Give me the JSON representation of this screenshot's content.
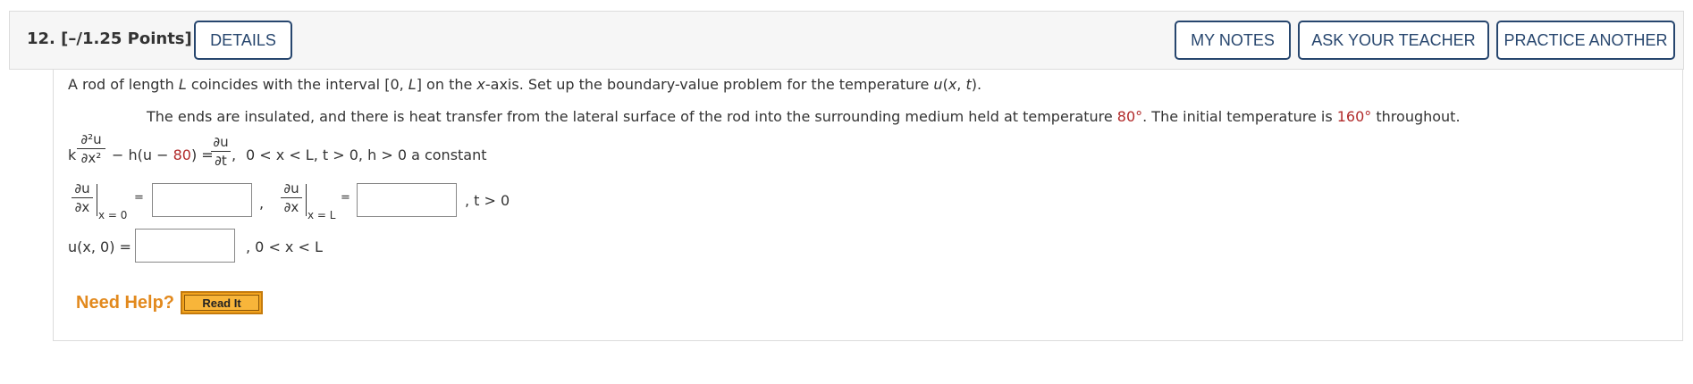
{
  "header": {
    "question_number": "12.",
    "points": "[–/1.25 Points]",
    "details_label": "DETAILS",
    "my_notes_label": "MY NOTES",
    "ask_teacher_label": "ASK YOUR TEACHER",
    "practice_label": "PRACTICE ANOTHER"
  },
  "problem": {
    "line1_a": "A rod of length ",
    "line1_L": "L",
    "line1_b": " coincides with the interval [0, ",
    "line1_L2": "L",
    "line1_c": "] on the ",
    "line1_x": "x",
    "line1_d": "-axis. Set up the boundary-value problem for the temperature ",
    "line1_u": "u",
    "line1_e": "(",
    "line1_x2": "x",
    "line1_f": ", ",
    "line1_t": "t",
    "line1_g": ").",
    "line2_a": "The ends are insulated, and there is heat transfer from the lateral surface of the rod into the surrounding medium held at temperature ",
    "line2_temp1": "80°",
    "line2_b": ". The initial temperature is ",
    "line2_temp2": "160°",
    "line2_c": " throughout."
  },
  "equation": {
    "k": "k",
    "d2u": "∂²u",
    "dx2": "∂x²",
    "minus_h": "− h(u − ",
    "medium_temp": "80",
    "close_eq": ") =",
    "du": "∂u",
    "dt": "∂t",
    "comma": ",",
    "conditions": "0 < x < L, t > 0,   h > 0 a constant"
  },
  "boundary": {
    "du": "∂u",
    "dx": "∂x",
    "at_x0": "x = 0",
    "at_xL": "x = L",
    "equals": "=",
    "comma": ",",
    "t_cond": ", t > 0"
  },
  "initial": {
    "label": "u(x, 0) =",
    "cond": ", 0 < x < L"
  },
  "inputs": {
    "bc_left": "",
    "bc_right": "",
    "ic": ""
  },
  "help": {
    "need_help": "Need Help?",
    "read_it": "Read It"
  },
  "colors": {
    "accent_blue": "#27466e",
    "value_red": "#b12a2a",
    "help_orange": "#e2891d"
  }
}
